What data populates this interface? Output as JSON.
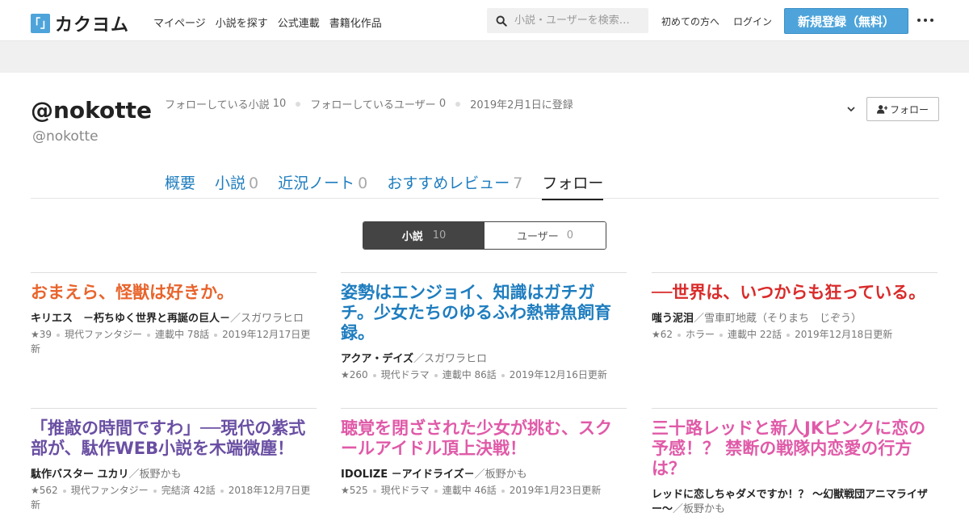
{
  "header": {
    "logo_mark": "「」",
    "logo_text": "カクヨム",
    "nav": [
      "マイページ",
      "小説を探す",
      "公式連載",
      "書籍化作品"
    ],
    "search_placeholder": "小説・ユーザーを検索…",
    "first_time": "初めての方へ",
    "login": "ログイン",
    "register": "新規登録（無料）"
  },
  "profile": {
    "display_name": "@nokotte",
    "user_id": "@nokotte",
    "following_novels_label": "フォローしている小説",
    "following_novels_count": "10",
    "following_users_label": "フォローしているユーザー",
    "following_users_count": "0",
    "registered": "2019年2月1日に登録",
    "follow_button": "フォロー"
  },
  "tabs": [
    {
      "label": "概要",
      "count": ""
    },
    {
      "label": "小説",
      "count": "0"
    },
    {
      "label": "近況ノート",
      "count": "0"
    },
    {
      "label": "おすすめレビュー",
      "count": "7"
    },
    {
      "label": "フォロー",
      "count": ""
    }
  ],
  "toggle": {
    "novels_label": "小説",
    "novels_count": "10",
    "users_label": "ユーザー",
    "users_count": "0"
  },
  "cards": [
    {
      "title": "おまえら、怪獣は好きか。",
      "title_color": "#e8642c",
      "series": "キリエス　－朽ちゆく世界と再誕の巨人－",
      "author": "／スガワラヒロ",
      "stars": "★39",
      "genre": "現代ファンタジー",
      "status": "連載中 78話",
      "updated": "2019年12月17日更新"
    },
    {
      "title": "姿勢はエンジョイ、知識はガチガチ。少女たちのゆるふわ熱帯魚飼育録。",
      "title_color": "#1e7dbf",
      "series": "アクア・デイズ",
      "author": "／スガワラヒロ",
      "stars": "★260",
      "genre": "現代ドラマ",
      "status": "連載中 86話",
      "updated": "2019年12月16日更新"
    },
    {
      "title": "──世界は、いつからも狂っている。",
      "title_color": "#d92b2b",
      "series": "嗤う泥泪",
      "author": "／雪車町地蔵（そりまち　じぞう）",
      "stars": "★62",
      "genre": "ホラー",
      "status": "連載中 22話",
      "updated": "2019年12月18日更新"
    },
    {
      "title": "「推敲の時間ですわ」──現代の紫式部が、駄作WEB小説を木端微塵！",
      "title_color": "#6a4fa3",
      "series": "駄作バスター ユカリ",
      "author": "／板野かも",
      "stars": "★562",
      "genre": "現代ファンタジー",
      "status": "完結済 42話",
      "updated": "2018年12月7日更新"
    },
    {
      "title": "聴覚を閉ざされた少女が挑む、スクールアイドル頂上決戦！",
      "title_color": "#e05aa8",
      "series": "IDOLIZE －アイドライズ－",
      "author": "／板野かも",
      "stars": "★525",
      "genre": "現代ドラマ",
      "status": "連載中 46話",
      "updated": "2019年1月23日更新"
    },
    {
      "title": "三十路レッドと新人JKピンクに恋の予感！？ 禁断の戦隊内恋愛の行方は？",
      "title_color": "#e05aa8",
      "series": "レッドに恋しちゃダメですか！？ ～幻獣戦団アニマライザー～",
      "author": "／板野かも",
      "stars": "",
      "genre": "",
      "status": "",
      "updated": ""
    }
  ]
}
